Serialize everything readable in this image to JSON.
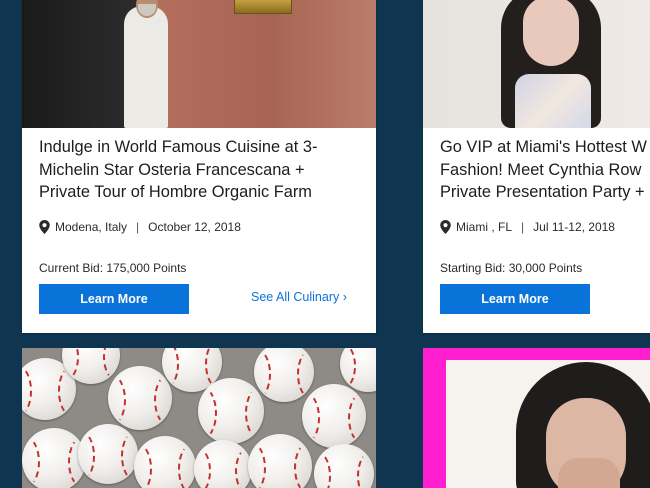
{
  "cards": [
    {
      "title_lines": [
        "Indulge in World Famous Cuisine at 3-",
        "Michelin Star Osteria Francescana +",
        "Private Tour of Hombre Organic Farm"
      ],
      "location": "Modena, Italy",
      "date": "October 12, 2018",
      "bid": "Current Bid: 175,000 Points",
      "button_label": "Learn More",
      "see_all_label": "See All Culinary ›"
    },
    {
      "title_lines": [
        "Go VIP at Miami's Hottest W",
        "Fashion! Meet Cynthia Row",
        "Private Presentation Party +"
      ],
      "location": "Miami , FL",
      "date": "Jul 11-12, 2018",
      "bid": "Starting Bid: 30,000 Points",
      "button_label": "Learn More"
    }
  ],
  "icons": {
    "location": "map-pin-icon"
  },
  "colors": {
    "background": "#0f3550",
    "accent": "#0a73d9",
    "magenta_frame": "#ff1fd1"
  }
}
